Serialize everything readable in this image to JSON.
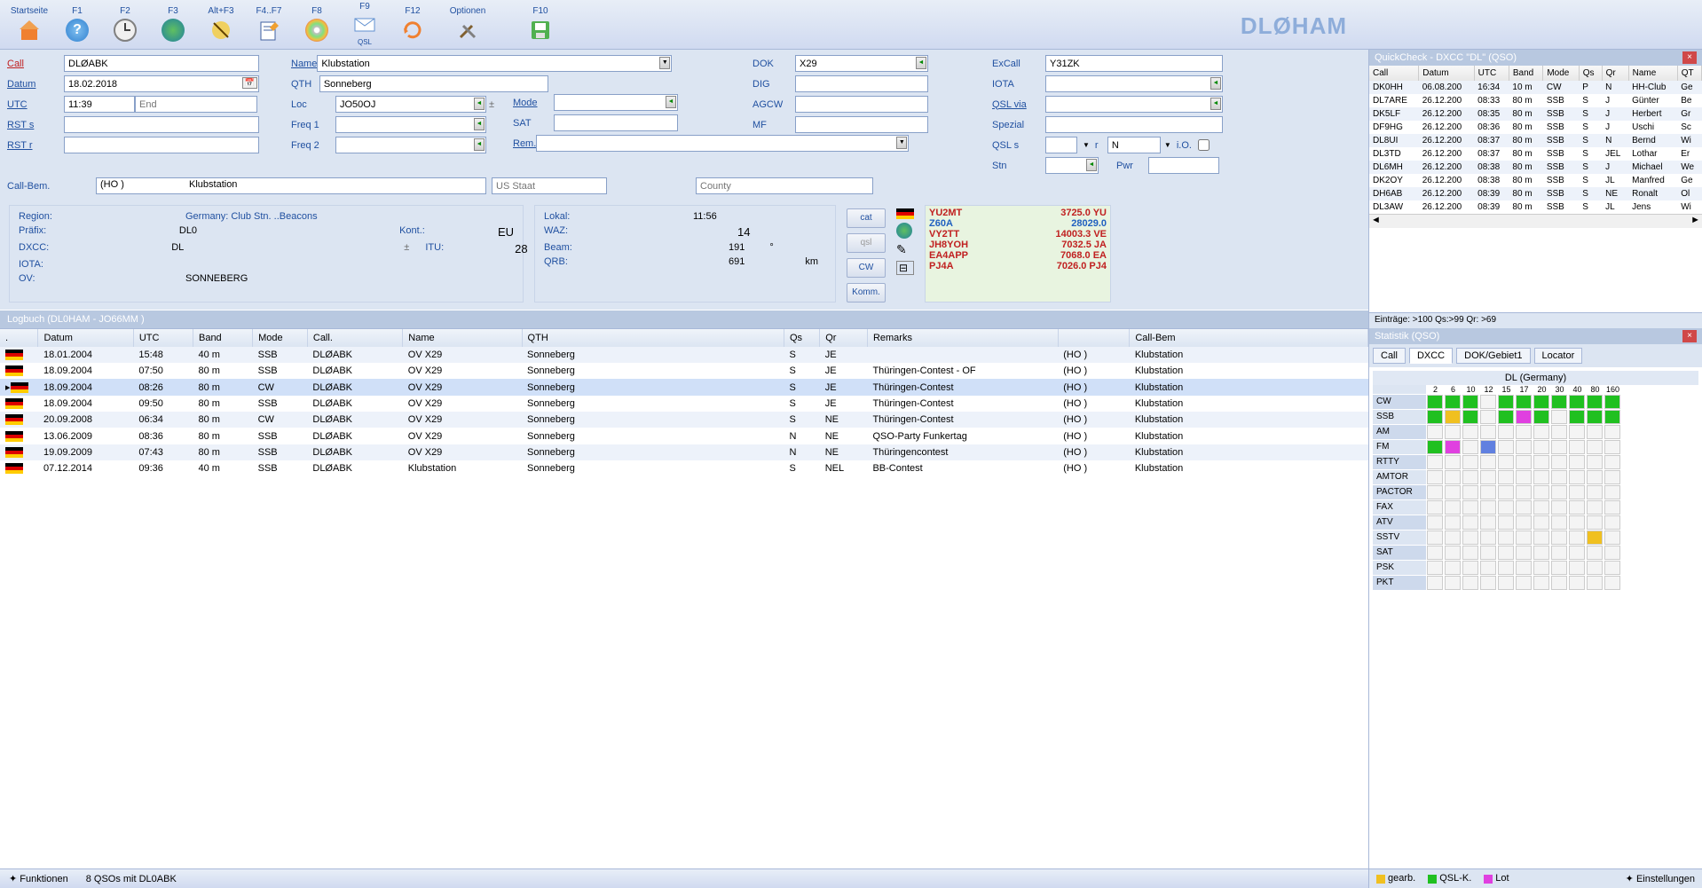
{
  "toolbar": {
    "items": [
      {
        "label": "Startseite",
        "icon": "home"
      },
      {
        "label": "F1",
        "icon": "help"
      },
      {
        "label": "F2",
        "icon": "clock"
      },
      {
        "label": "F3",
        "icon": "globe"
      },
      {
        "label": "Alt+F3",
        "icon": "satellite"
      },
      {
        "label": "F4..F7",
        "icon": "edit"
      },
      {
        "label": "F8",
        "icon": "disc"
      },
      {
        "label": "F9",
        "icon": "qsl",
        "sub": "QSL"
      },
      {
        "label": "F12",
        "icon": "refresh"
      },
      {
        "label": "Optionen",
        "icon": "tools"
      },
      {
        "label": "F10",
        "icon": "save"
      }
    ],
    "brand": "DLØHAM"
  },
  "form": {
    "call_lbl": "Call",
    "call": "DLØABK",
    "datum_lbl": "Datum",
    "datum": "18.02.2018",
    "utc_lbl": "UTC",
    "utc": "11:39",
    "end_ph": "End",
    "rsts_lbl": "RST s",
    "rsts": "",
    "rstr_lbl": "RST r",
    "rstr": "",
    "callbem_lbl": "Call-Bem.",
    "name_lbl": "Name",
    "name": "Klubstation",
    "qth_lbl": "QTH",
    "qth": "Sonneberg",
    "loc_lbl": "Loc",
    "loc": "JO50OJ",
    "freq1_lbl": "Freq 1",
    "freq1": "",
    "freq2_lbl": "Freq 2",
    "freq2": "",
    "mode_lbl": "Mode",
    "mode": "",
    "sat_lbl": "SAT",
    "sat": "",
    "rem_lbl": "Rem.",
    "rem": "",
    "dok_lbl": "DOK",
    "dok": "X29",
    "dig_lbl": "DIG",
    "dig": "",
    "agcw_lbl": "AGCW",
    "agcw": "",
    "mf_lbl": "MF",
    "mf": "",
    "excall_lbl": "ExCall",
    "excall": "Y31ZK",
    "iota_lbl": "IOTA",
    "iota": "",
    "qslvia_lbl": "QSL via",
    "qslvia": "",
    "spezial_lbl": "Spezial",
    "spezial": "",
    "qsls_lbl": "QSL s",
    "r_lbl": "r",
    "r_val": "N",
    "io_lbl": "i.O.",
    "stn_lbl": "Stn",
    "pwr_lbl": "Pwr",
    "calbem_val1": "(HO )",
    "calbem_val2": "Klubstation",
    "usstaat_ph": "US Staat",
    "county_ph": "County"
  },
  "status": {
    "region_lbl": "Region:",
    "region": "Germany: Club Stn.   ..Beacons",
    "prefix_lbl": "Präfix:",
    "prefix": "DL0",
    "dxcc_lbl": "DXCC:",
    "dxcc": "DL",
    "iota_lbl": "IOTA:",
    "ov_lbl": "OV:",
    "ov": "SONNEBERG",
    "kont_lbl": "Kont.:",
    "kont": "EU",
    "itu_lbl": "ITU:",
    "itu": "28",
    "lokal_lbl": "Lokal:",
    "lokal": "11:56",
    "waz_lbl": "WAZ:",
    "waz": "14",
    "beam_lbl": "Beam:",
    "beam": "191",
    "beam_u": "°",
    "qrb_lbl": "QRB:",
    "qrb": "691",
    "qrb_u": "km"
  },
  "vbtns": [
    "cat",
    "qsl",
    "CW",
    "Komm."
  ],
  "cluster": [
    {
      "call": "YU2MT",
      "freq": "3725.0 YU",
      "c": "red"
    },
    {
      "call": "Z60A",
      "freq": "28029.0",
      "c": "blue"
    },
    {
      "call": "VY2TT",
      "freq": "14003.3 VE",
      "c": "red"
    },
    {
      "call": "JH8YOH",
      "freq": "7032.5 JA",
      "c": "red"
    },
    {
      "call": "EA4APP",
      "freq": "7068.0 EA",
      "c": "red"
    },
    {
      "call": "PJ4A",
      "freq": "7026.0 PJ4",
      "c": "red"
    }
  ],
  "logbook": {
    "title": "Logbuch  (DL0HAM - JO66MM )",
    "headers": [
      ".",
      "Datum",
      "UTC",
      "Band",
      "Mode",
      "Call.",
      "Name",
      "QTH",
      "Qs",
      "Qr",
      "Remarks",
      "",
      "Call-Bem"
    ],
    "rows": [
      {
        "datum": "18.01.2004",
        "utc": "15:48",
        "band": "40 m",
        "mode": "SSB",
        "call": "DLØABK",
        "name": "OV X29",
        "qth": "Sonneberg",
        "qs": "S",
        "qr": "JE",
        "remarks": "",
        "ho": "(HO )",
        "cb": "Klubstation"
      },
      {
        "datum": "18.09.2004",
        "utc": "07:50",
        "band": "80 m",
        "mode": "SSB",
        "call": "DLØABK",
        "name": "OV X29",
        "qth": "Sonneberg",
        "qs": "S",
        "qr": "JE",
        "remarks": "Thüringen-Contest - OF",
        "ho": "(HO )",
        "cb": "Klubstation"
      },
      {
        "datum": "18.09.2004",
        "utc": "08:26",
        "band": "80 m",
        "mode": "CW",
        "call": "DLØABK",
        "name": "OV X29",
        "qth": "Sonneberg",
        "qs": "S",
        "qr": "JE",
        "remarks": "Thüringen-Contest",
        "ho": "(HO )",
        "cb": "Klubstation",
        "sel": true
      },
      {
        "datum": "18.09.2004",
        "utc": "09:50",
        "band": "80 m",
        "mode": "SSB",
        "call": "DLØABK",
        "name": "OV X29",
        "qth": "Sonneberg",
        "qs": "S",
        "qr": "JE",
        "remarks": "Thüringen-Contest",
        "ho": "(HO )",
        "cb": "Klubstation"
      },
      {
        "datum": "20.09.2008",
        "utc": "06:34",
        "band": "80 m",
        "mode": "CW",
        "call": "DLØABK",
        "name": "OV X29",
        "qth": "Sonneberg",
        "qs": "S",
        "qr": "NE",
        "remarks": "Thüringen-Contest",
        "ho": "(HO )",
        "cb": "Klubstation"
      },
      {
        "datum": "13.06.2009",
        "utc": "08:36",
        "band": "80 m",
        "mode": "SSB",
        "call": "DLØABK",
        "name": "OV X29",
        "qth": "Sonneberg",
        "qs": "N",
        "qr": "NE",
        "remarks": "QSO-Party Funkertag",
        "ho": "(HO )",
        "cb": "Klubstation"
      },
      {
        "datum": "19.09.2009",
        "utc": "07:43",
        "band": "80 m",
        "mode": "SSB",
        "call": "DLØABK",
        "name": "OV X29",
        "qth": "Sonneberg",
        "qs": "N",
        "qr": "NE",
        "remarks": "Thüringencontest",
        "ho": "(HO )",
        "cb": "Klubstation"
      },
      {
        "datum": "07.12.2014",
        "utc": "09:36",
        "band": "40 m",
        "mode": "SSB",
        "call": "DLØABK",
        "name": "Klubstation",
        "qth": "Sonneberg",
        "qs": "S",
        "qr": "NEL",
        "remarks": "BB-Contest",
        "ho": "(HO )",
        "cb": "Klubstation"
      }
    ]
  },
  "footer": {
    "funktionen": "Funktionen",
    "qsos": "8 QSOs mit DL0ABK"
  },
  "quickcheck": {
    "title": "QuickCheck - DXCC \"DL\" (QSO)",
    "headers": [
      "Call",
      "Datum",
      "UTC",
      "Band",
      "Mode",
      "Qs",
      "Qr",
      "Name",
      "QT"
    ],
    "rows": [
      {
        "call": "DK0HH",
        "datum": "06.08.200",
        "utc": "16:34",
        "band": "10 m",
        "mode": "CW",
        "qs": "P",
        "qr": "N",
        "name": "HH-Club",
        "qth": "Ge"
      },
      {
        "call": "DL7ARE",
        "datum": "26.12.200",
        "utc": "08:33",
        "band": "80 m",
        "mode": "SSB",
        "qs": "S",
        "qr": "J",
        "name": "Günter",
        "qth": "Be"
      },
      {
        "call": "DK5LF",
        "datum": "26.12.200",
        "utc": "08:35",
        "band": "80 m",
        "mode": "SSB",
        "qs": "S",
        "qr": "J",
        "name": "Herbert",
        "qth": "Gr"
      },
      {
        "call": "DF9HG",
        "datum": "26.12.200",
        "utc": "08:36",
        "band": "80 m",
        "mode": "SSB",
        "qs": "S",
        "qr": "J",
        "name": "Uschi",
        "qth": "Sc"
      },
      {
        "call": "DL8UI",
        "datum": "26.12.200",
        "utc": "08:37",
        "band": "80 m",
        "mode": "SSB",
        "qs": "S",
        "qr": "N",
        "name": "Bernd",
        "qth": "Wi"
      },
      {
        "call": "DL3TD",
        "datum": "26.12.200",
        "utc": "08:37",
        "band": "80 m",
        "mode": "SSB",
        "qs": "S",
        "qr": "JEL",
        "name": "Lothar",
        "qth": "Er"
      },
      {
        "call": "DL6MH",
        "datum": "26.12.200",
        "utc": "08:38",
        "band": "80 m",
        "mode": "SSB",
        "qs": "S",
        "qr": "J",
        "name": "Michael",
        "qth": "We"
      },
      {
        "call": "DK2OY",
        "datum": "26.12.200",
        "utc": "08:38",
        "band": "80 m",
        "mode": "SSB",
        "qs": "S",
        "qr": "JL",
        "name": "Manfred",
        "qth": "Ge"
      },
      {
        "call": "DH6AB",
        "datum": "26.12.200",
        "utc": "08:39",
        "band": "80 m",
        "mode": "SSB",
        "qs": "S",
        "qr": "NE",
        "name": "Ronalt",
        "qth": "Ol"
      },
      {
        "call": "DL3AW",
        "datum": "26.12.200",
        "utc": "08:39",
        "band": "80 m",
        "mode": "SSB",
        "qs": "S",
        "qr": "JL",
        "name": "Jens",
        "qth": "Wi"
      }
    ],
    "footer": "Einträge: >100     Qs:>99       Qr: >69"
  },
  "statistik": {
    "title": "Statistik (QSO)",
    "tabs": [
      "Call",
      "DXCC",
      "DOK/Gebiet1",
      "Locator"
    ],
    "active_tab": 1,
    "country": "DL (Germany)",
    "bands": [
      "2",
      "6",
      "10",
      "12",
      "15",
      "17",
      "20",
      "30",
      "40",
      "80",
      "160"
    ],
    "modes": [
      {
        "m": "CW",
        "c": [
          "g",
          "g",
          "g",
          "",
          "g",
          "g",
          "g",
          "g",
          "g",
          "g",
          "g"
        ]
      },
      {
        "m": "SSB",
        "c": [
          "g",
          "y",
          "g",
          "",
          "g",
          "m",
          "g",
          "",
          "g",
          "g",
          "g"
        ]
      },
      {
        "m": "AM",
        "c": [
          "",
          "",
          "",
          "",
          "",
          "",
          "",
          "",
          "",
          "",
          ""
        ]
      },
      {
        "m": "FM",
        "c": [
          "g",
          "m",
          "",
          "b",
          "",
          "",
          "",
          "",
          "",
          "",
          ""
        ]
      },
      {
        "m": "RTTY",
        "c": [
          "",
          "",
          "",
          "",
          "",
          "",
          "",
          "",
          "",
          "",
          ""
        ]
      },
      {
        "m": "AMTOR",
        "c": [
          "",
          "",
          "",
          "",
          "",
          "",
          "",
          "",
          "",
          "",
          ""
        ]
      },
      {
        "m": "PACTOR",
        "c": [
          "",
          "",
          "",
          "",
          "",
          "",
          "",
          "",
          "",
          "",
          ""
        ]
      },
      {
        "m": "FAX",
        "c": [
          "",
          "",
          "",
          "",
          "",
          "",
          "",
          "",
          "",
          "",
          ""
        ]
      },
      {
        "m": "ATV",
        "c": [
          "",
          "",
          "",
          "",
          "",
          "",
          "",
          "",
          "",
          "",
          ""
        ]
      },
      {
        "m": "SSTV",
        "c": [
          "",
          "",
          "",
          "",
          "",
          "",
          "",
          "",
          "",
          "y",
          ""
        ]
      },
      {
        "m": "SAT",
        "c": [
          "",
          "",
          "",
          "",
          "",
          "",
          "",
          "",
          "",
          "",
          ""
        ]
      },
      {
        "m": "PSK",
        "c": [
          "",
          "",
          "",
          "",
          "",
          "",
          "",
          "",
          "",
          "",
          ""
        ]
      },
      {
        "m": "PKT",
        "c": [
          "",
          "",
          "",
          "",
          "",
          "",
          "",
          "",
          "",
          "",
          ""
        ]
      }
    ],
    "legend": [
      {
        "c": "y",
        "t": "gearb."
      },
      {
        "c": "g",
        "t": "QSL-K."
      },
      {
        "c": "m",
        "t": "Lot"
      }
    ],
    "settings": "Einstellungen"
  }
}
